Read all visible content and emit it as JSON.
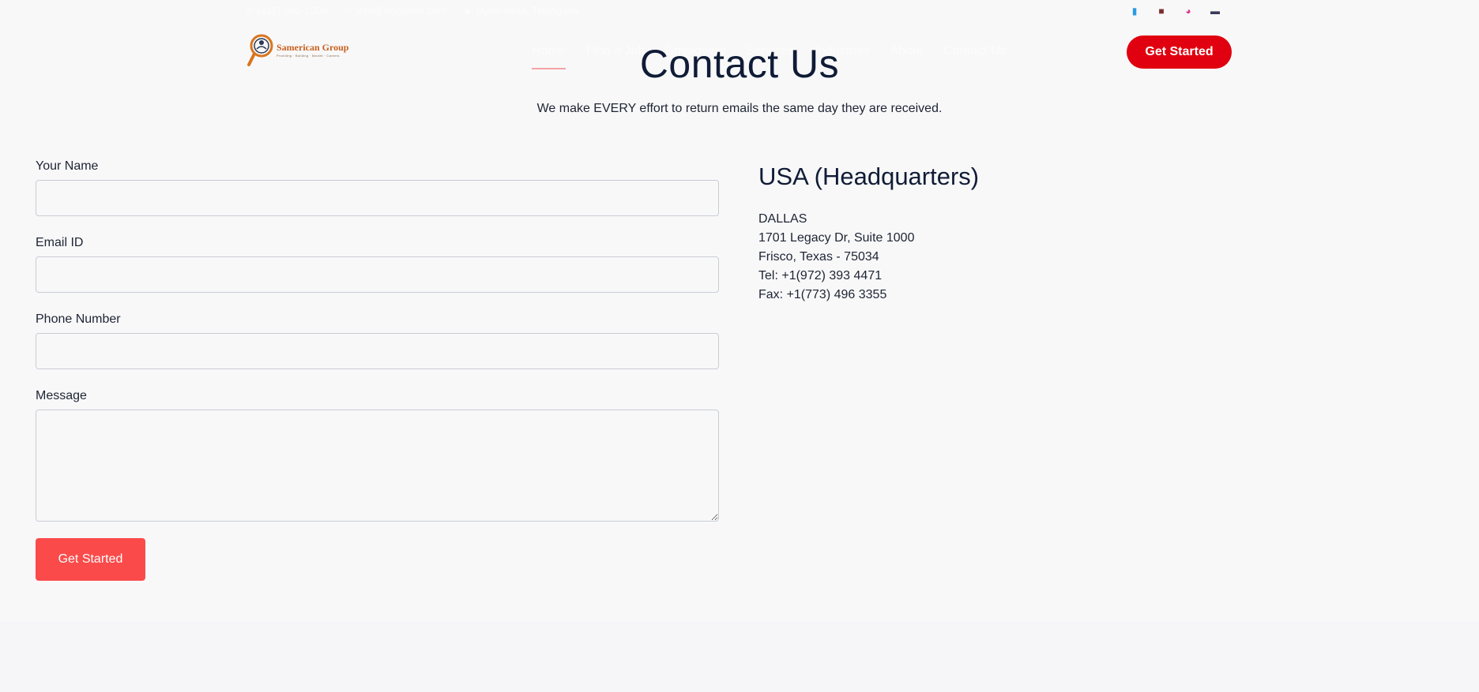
{
  "topbar": {
    "phone": "(415) 800-1000",
    "email": "info@w3global.com",
    "location": "Hyderabad, Telangana",
    "social_icons": [
      "facebook-icon",
      "linkedin-icon",
      "instagram-icon",
      "youtube-icon"
    ]
  },
  "logo": {
    "name": "Samerican Group",
    "tagline": "Providing · Building · Market · Careers"
  },
  "nav": {
    "items": [
      "Home",
      "Find a Job",
      "Employers",
      "Services",
      "Industries",
      "About",
      "Contact Us"
    ],
    "active": "Home",
    "cta": "Get Started"
  },
  "hero": {
    "title": "Contact Us",
    "subtitle": "We make EVERY effort to return emails the same day they are received."
  },
  "form": {
    "name_label": "Your Name",
    "name_value": "",
    "email_label": "Email ID",
    "email_value": "",
    "phone_label": "Phone Number",
    "phone_value": "",
    "message_label": "Message",
    "message_value": "",
    "submit": "Get Started"
  },
  "office": {
    "heading": "USA (Headquarters)",
    "city": "DALLAS",
    "address1": "1701 Legacy Dr, Suite 1000",
    "address2": "Frisco, Texas - 75034",
    "tel": "Tel: +1(972) 393 4471",
    "fax": "Fax: +1(773) 496 3355"
  },
  "colors": {
    "brand_red": "#e0000f",
    "submit_red": "#fb4a4a",
    "logo_orange": "#c8611e",
    "text_dark": "#101c36"
  }
}
